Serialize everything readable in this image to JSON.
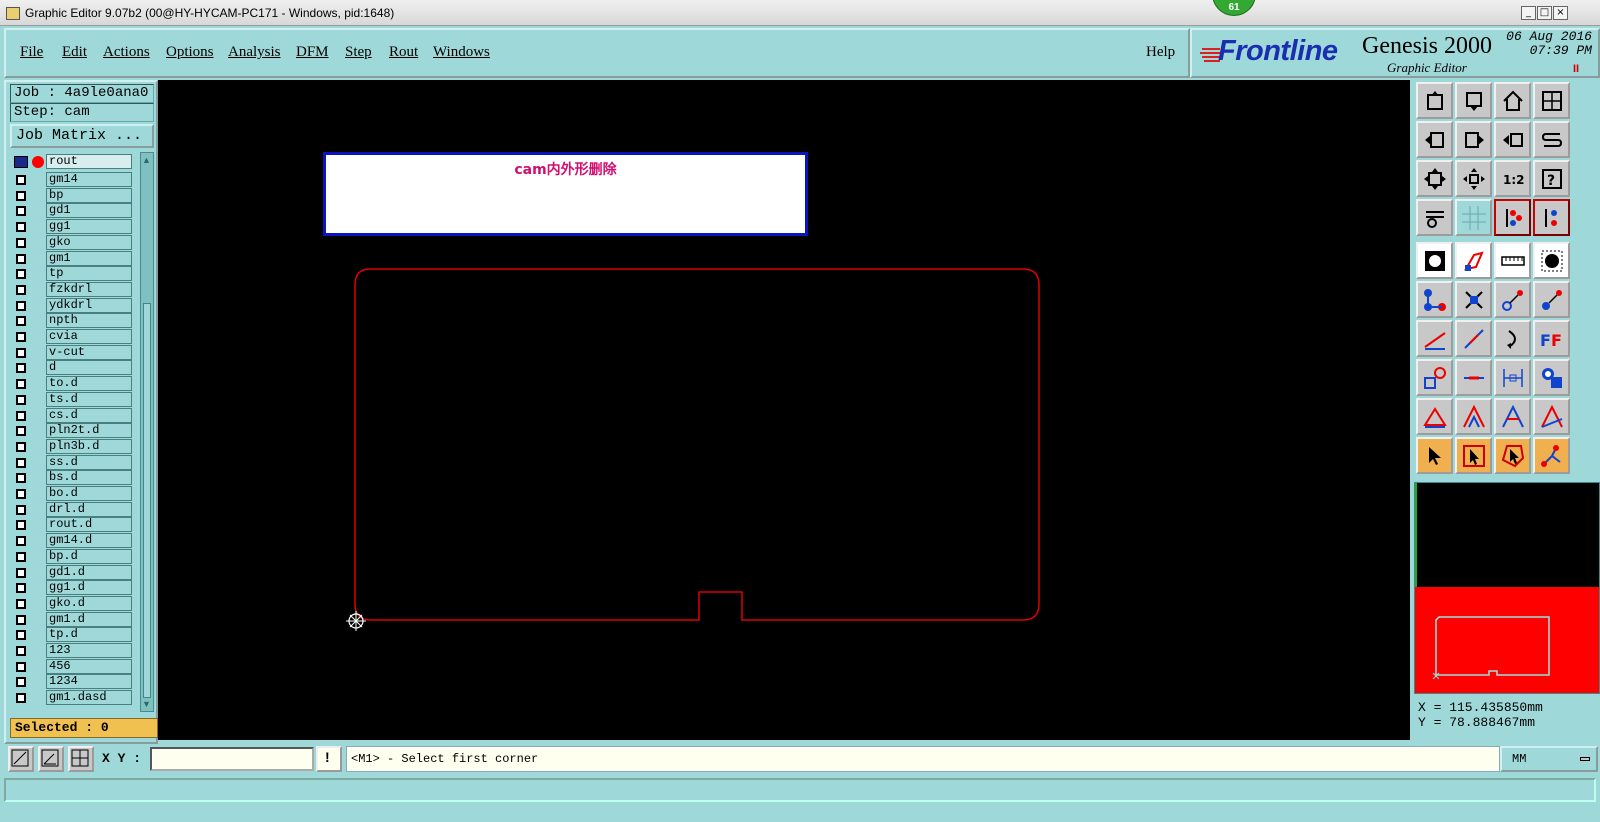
{
  "window": {
    "title": "Graphic Editor 9.07b2 (00@HY-HYCAM-PC171 - Windows, pid:1648)",
    "badge": "61",
    "minimize": "_",
    "maximize": "□",
    "close": "×"
  },
  "menu": {
    "items": [
      "File",
      "Edit",
      "Actions",
      "Options",
      "Analysis",
      "DFM",
      "Step",
      "Rout",
      "Windows"
    ],
    "help": "Help"
  },
  "brand": {
    "logo": "Frontline",
    "product": "Genesis 2000",
    "subtitle": "Graphic Editor",
    "date": "06 Aug 2016",
    "time": "07:39 PM",
    "pause": "II"
  },
  "left_panel": {
    "job": "Job : 4a9le0ana0",
    "step": "Step: cam",
    "job_matrix": "Job Matrix ...",
    "layers": [
      "gm14",
      "bp",
      "gd1",
      "gg1",
      "gko",
      "gm1",
      "tp",
      "fzkdrl",
      "ydkdrl",
      "npth",
      "cvia",
      "v-cut",
      "d",
      "to.d",
      "ts.d",
      "cs.d",
      "pln2t.d",
      "pln3b.d",
      "ss.d",
      "bs.d",
      "bo.d",
      "drl.d",
      "rout.d",
      "gm14.d",
      "bp.d",
      "gd1.d",
      "gg1.d",
      "gko.d",
      "gm1.d",
      "tp.d",
      "123",
      "456",
      "1234",
      "gm1.dasd"
    ],
    "active_layer": "rout",
    "selected": "Selected : 0"
  },
  "canvas": {
    "note": "cam内外形删除",
    "outline_color": "#e00000",
    "background": "#000000"
  },
  "status": {
    "x": "X = 115.435850mm",
    "y": "Y = 78.888467mm",
    "xy_label": "X Y :",
    "prompt": "<M1> - Select first corner",
    "units": "MM",
    "warn_icon": "!"
  },
  "colors": {
    "panel": "#9fd8d8",
    "accent_red": "#ff0000",
    "selected_bg": "#f0c050"
  }
}
